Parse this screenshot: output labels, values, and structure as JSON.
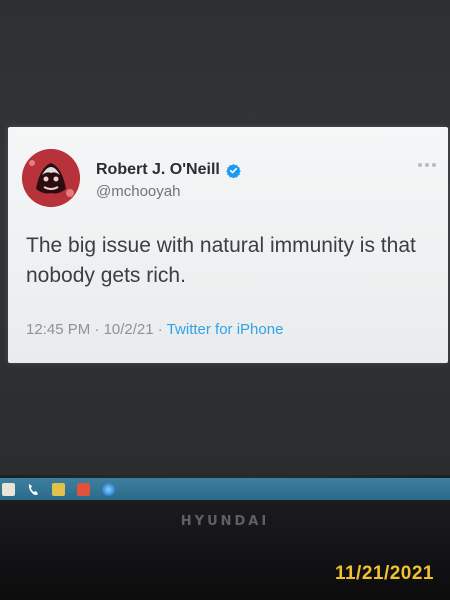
{
  "tweet": {
    "author_name": "Robert J. O'Neill",
    "handle": "@mchooyah",
    "text": "The big issue with natural immunity is that nobody gets rich.",
    "time": "12:45 PM",
    "separator1": "·",
    "date": "10/2/21",
    "separator2": "·",
    "source": "Twitter for iPhone",
    "verified_color": "#1d9bf0",
    "source_color": "#2fa3e6",
    "icons": {
      "verified": "verified-badge-icon",
      "more": "more-options-icon",
      "avatar": "profile-avatar"
    }
  },
  "taskbar": {
    "icons": [
      "start-icon",
      "phone-icon",
      "folder-icon",
      "office-icon",
      "browser-icon"
    ],
    "color": "#2d6a8a"
  },
  "monitor": {
    "brand": "HYUNDAI"
  },
  "photo_stamp": {
    "date": "11/21/2021",
    "color": "#f2c12e"
  }
}
